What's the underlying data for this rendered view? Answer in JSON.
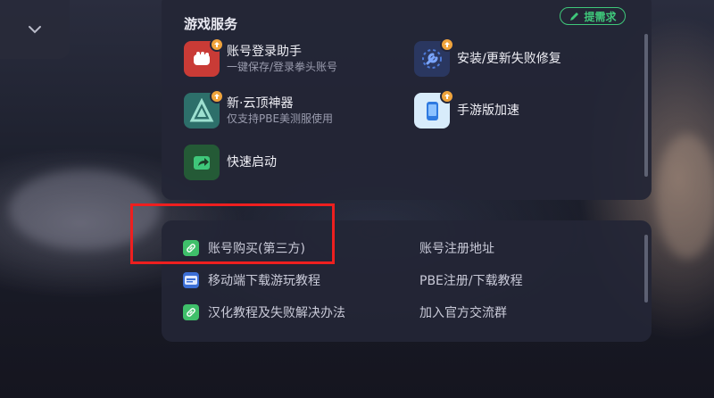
{
  "section": {
    "title": "游戏服务",
    "request_label": "提需求"
  },
  "services": [
    {
      "title": "账号登录助手",
      "subtitle": "一键保存/登录拳头账号",
      "icon": "fist-icon"
    },
    {
      "title": "安装/更新失败修复",
      "subtitle": "",
      "icon": "wrench-icon"
    },
    {
      "title": "新·云顶神器",
      "subtitle": "仅支持PBE美测服使用",
      "icon": "tft-logo-icon"
    },
    {
      "title": "手游版加速",
      "subtitle": "",
      "icon": "phone-icon"
    },
    {
      "title": "快速启动",
      "subtitle": "",
      "icon": "quick-launch-icon"
    }
  ],
  "links": [
    {
      "label": "账号购买(第三方)",
      "icon": "link-icon"
    },
    {
      "label": "账号注册地址",
      "icon": ""
    },
    {
      "label": "移动端下载游玩教程",
      "icon": "wiki-icon"
    },
    {
      "label": "PBE注册/下载教程",
      "icon": ""
    },
    {
      "label": "汉化教程及失败解决办法",
      "icon": "link-icon"
    },
    {
      "label": "加入官方交流群",
      "icon": ""
    }
  ],
  "colors": {
    "accent_green": "#3fc77a",
    "badge_orange": "#f0a43c",
    "highlight_red": "#ee1f1f"
  }
}
